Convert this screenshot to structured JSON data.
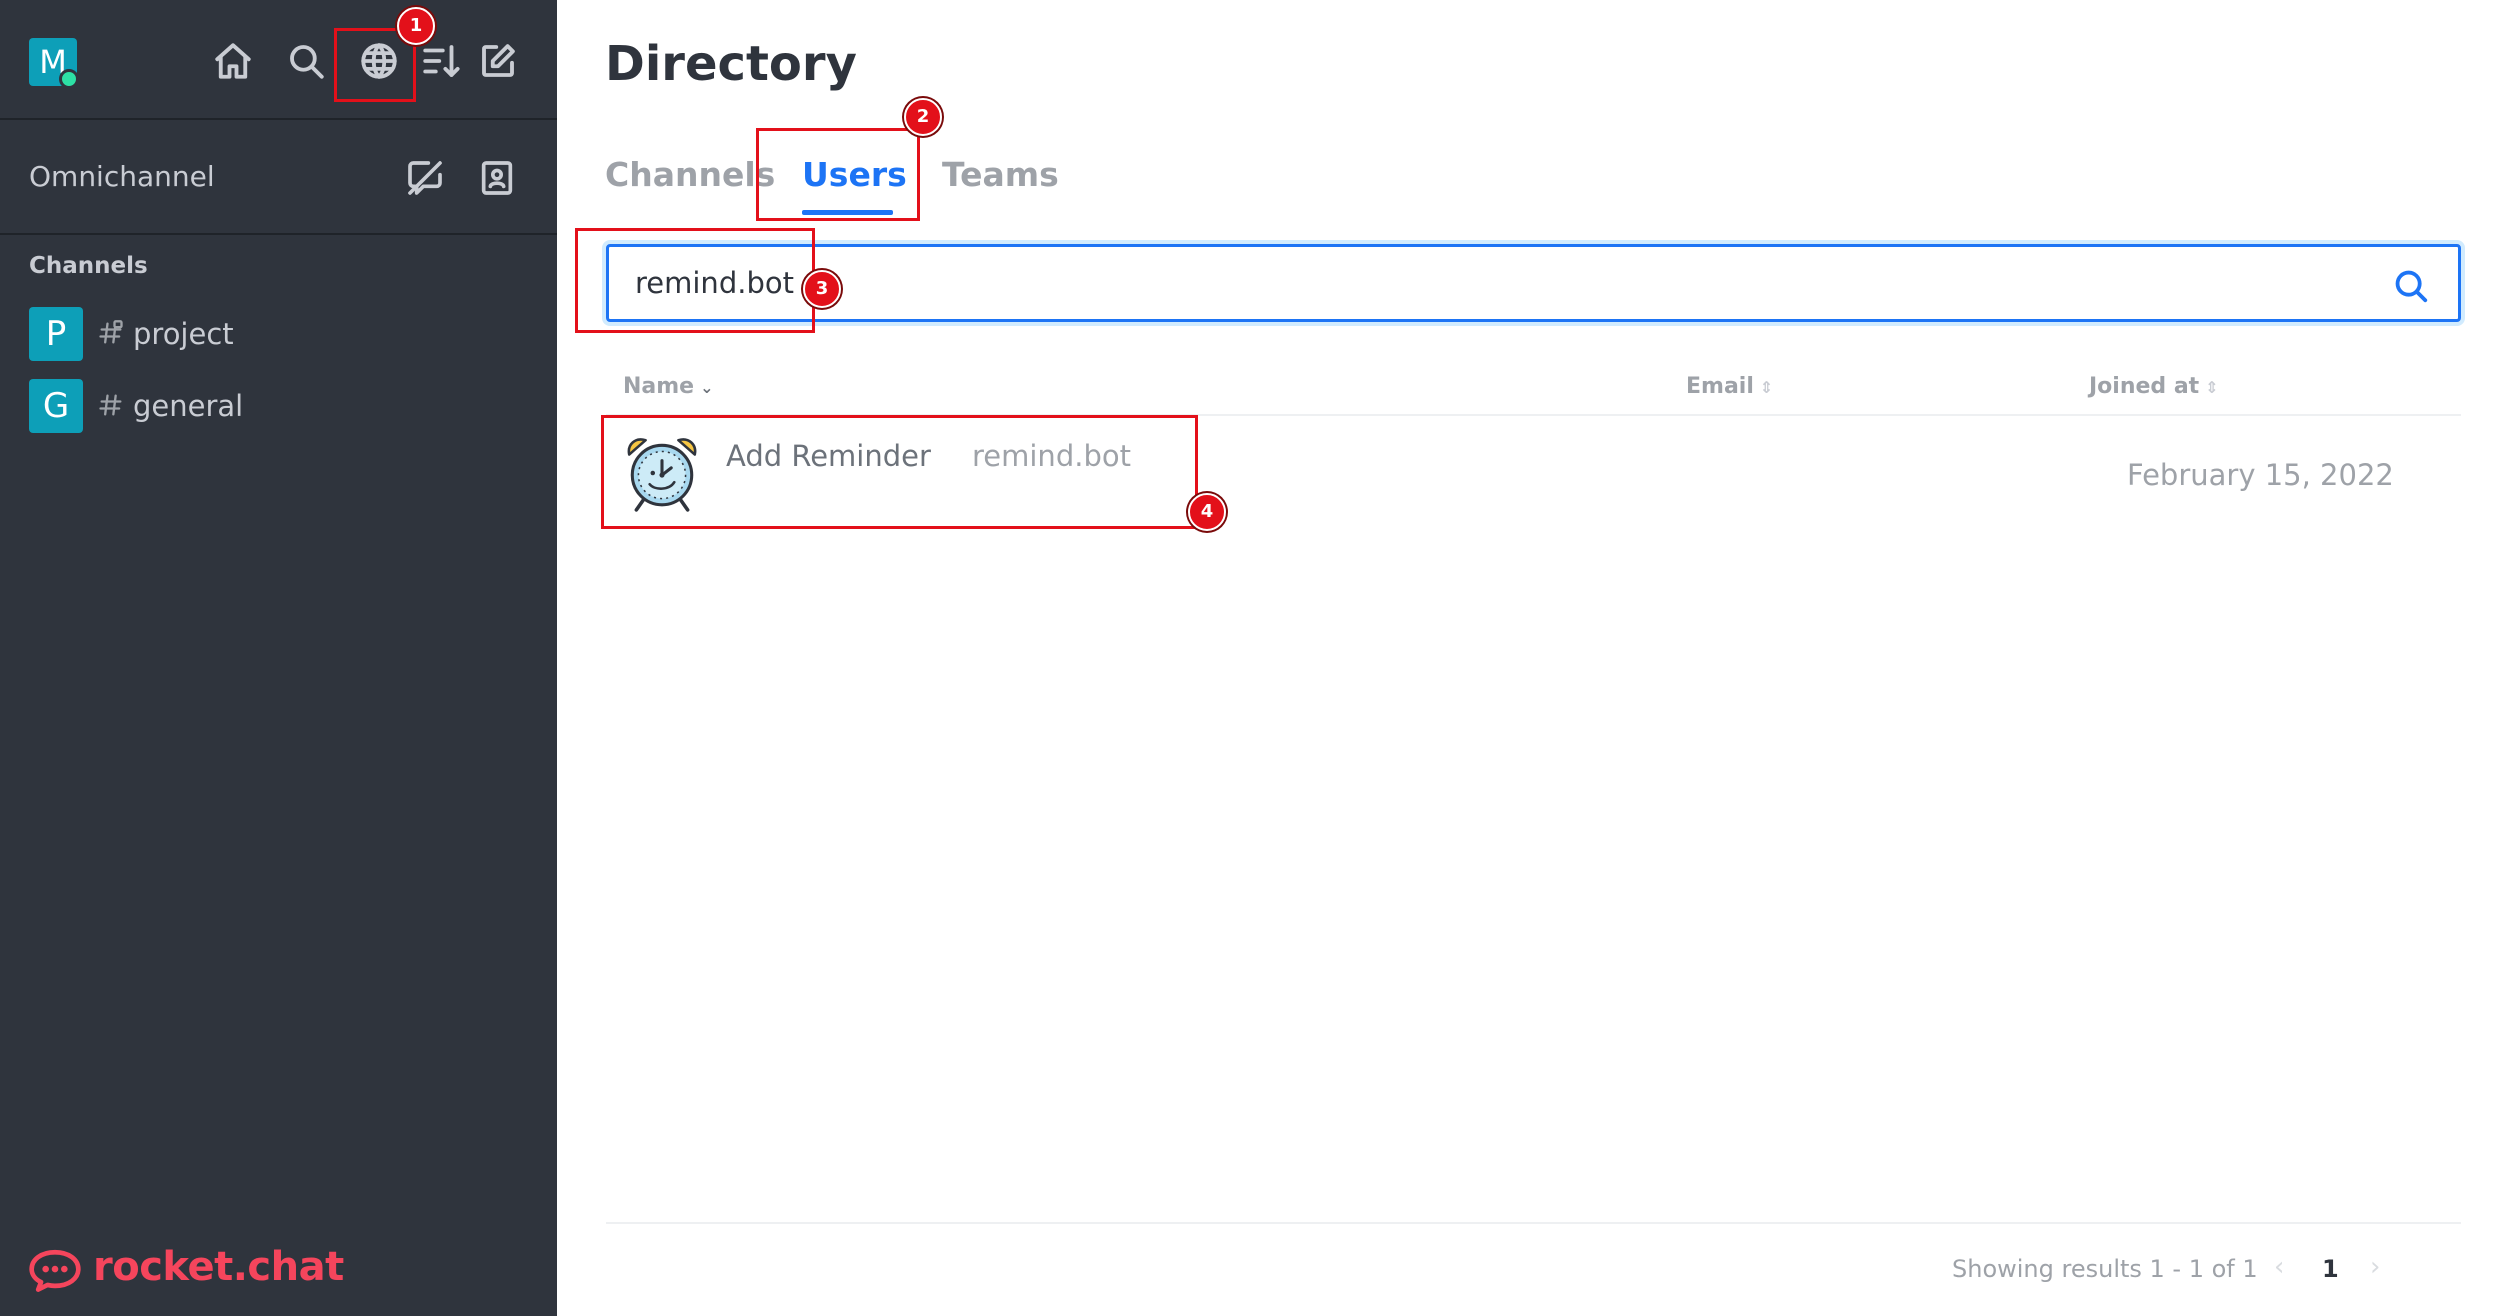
{
  "sidebar": {
    "user_avatar_letter": "M",
    "omnichannel_label": "Omnichannel",
    "section_title": "Channels",
    "rooms": [
      {
        "avatar_letter": "P",
        "name": "project"
      },
      {
        "avatar_letter": "G",
        "name": "general"
      }
    ],
    "brand_text": "rocket.chat"
  },
  "main": {
    "title": "Directory",
    "tabs": [
      {
        "label": "Channels",
        "active": false
      },
      {
        "label": "Users",
        "active": true
      },
      {
        "label": "Teams",
        "active": false
      }
    ],
    "search": {
      "value": "remind.bot",
      "placeholder": ""
    },
    "table": {
      "headers": [
        "Name",
        "Email",
        "Joined at"
      ],
      "rows": [
        {
          "name": "Add Reminder",
          "username": "remind.bot",
          "email": "",
          "joined_at": "February 15, 2022"
        }
      ]
    },
    "pagination": {
      "summary": "Showing results 1 - 1 of 1",
      "prev": "‹",
      "current_page": "1",
      "next": "›"
    }
  },
  "annotations": [
    "1",
    "2",
    "3",
    "4"
  ],
  "colors": {
    "sidebar_bg": "#2f343d",
    "accent": "#1d74f5",
    "avatar_bg": "#0d9fb8",
    "brand": "#f5455c",
    "annotation": "#e3101a"
  }
}
